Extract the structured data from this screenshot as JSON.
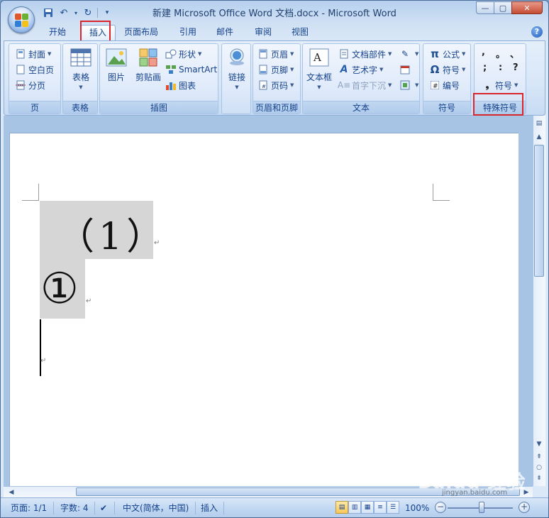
{
  "window": {
    "title": "新建 Microsoft Office Word 文档.docx - Microsoft Word",
    "controls": [
      "—",
      "▢",
      "✕"
    ]
  },
  "qat": {
    "save_icon": "save-icon",
    "undo_icon": "undo-icon",
    "redo_icon": "redo-icon",
    "customize_icon": "customize-icon"
  },
  "tabs": [
    {
      "label": "开始"
    },
    {
      "label": "插入"
    },
    {
      "label": "页面布局"
    },
    {
      "label": "引用"
    },
    {
      "label": "邮件"
    },
    {
      "label": "审阅"
    },
    {
      "label": "视图"
    }
  ],
  "active_tab": "插入",
  "ribbon": {
    "pages": {
      "label": "页",
      "buttons": [
        "封面",
        "空白页",
        "分页"
      ]
    },
    "tables": {
      "label": "表格",
      "button": "表格"
    },
    "illustrations": {
      "label": "插图",
      "picture": "图片",
      "clipart": "剪贴画",
      "shapes": "形状",
      "smartart": "SmartArt",
      "chart": "图表"
    },
    "links": {
      "label": "",
      "button": "链接"
    },
    "header_footer": {
      "label": "页眉和页脚",
      "buttons": [
        "页眉",
        "页脚",
        "页码"
      ]
    },
    "text": {
      "label": "文本",
      "textbox": "文本框",
      "quickparts": "文档部件",
      "wordart": "艺术字",
      "dropcap": "首字下沉"
    },
    "symbols": {
      "label": "符号",
      "equation": "公式",
      "symbol": "符号",
      "numbering": "编号"
    },
    "special": {
      "label": "特殊符号",
      "symbol_button": "符号",
      "symbols": [
        ",",
        "。",
        "、",
        ";",
        ":",
        "?"
      ]
    }
  },
  "document": {
    "line1": "（1）",
    "line2": "①",
    "para_mark": "↵"
  },
  "statusbar": {
    "page": "页面: 1/1",
    "words": "字数: 4",
    "language": "中文(简体，中国)",
    "mode": "插入",
    "zoom": "100%",
    "zoom_level_percent": 100
  },
  "watermark": {
    "brand": "Baidu 经验",
    "url": "jingyan.baidu.com"
  },
  "colors": {
    "highlight": "#d9252b",
    "ribbon_text": "#15428b",
    "selection": "#d6d6d6"
  }
}
